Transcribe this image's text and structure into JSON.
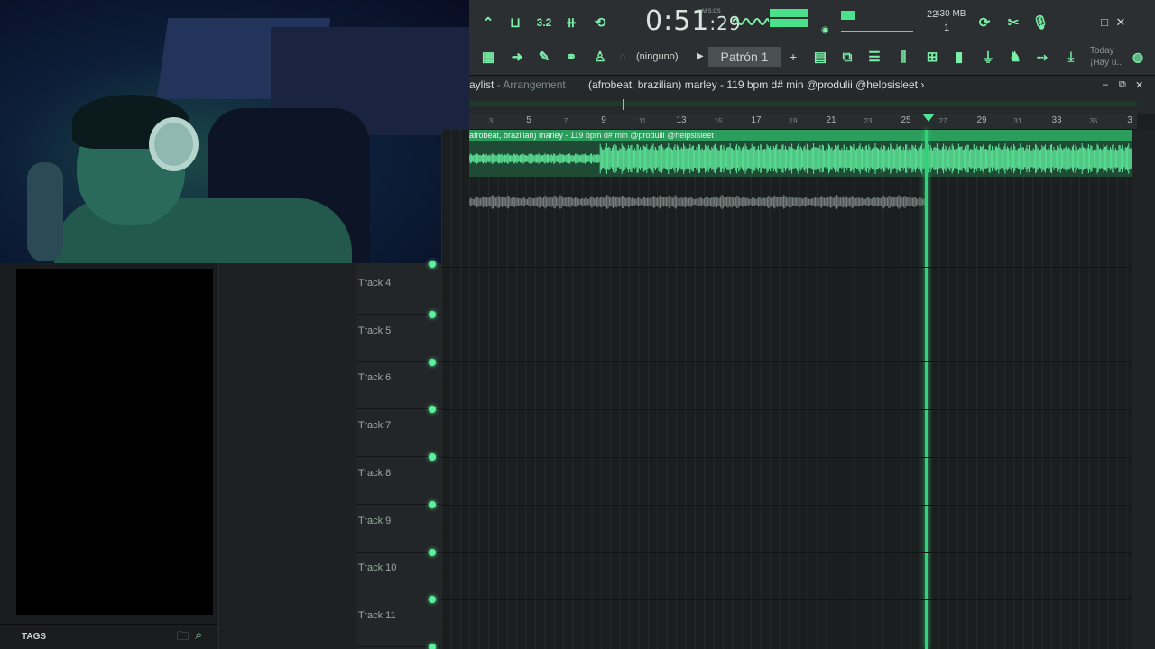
{
  "toolbar": {
    "time_main": "0:51",
    "time_sub": "29",
    "time_format_label": "M:S:CS",
    "cpu_value": "22",
    "memory": "430 MB",
    "voices": "1",
    "snap_label": "(ninguno)",
    "pattern_label": "Patrón 1",
    "pattern_add": "+",
    "today_line1": "Today",
    "today_line2": "¡Hay u..",
    "accent_color": "#4be08a"
  },
  "playlist": {
    "title_prefix": "aylist",
    "title_separator": " - ",
    "title_mode": "Arrangement",
    "pattern_name": "(afrobeat, brazilian) marley - 119 bpm d# min @produlii @helpsisleet",
    "pattern_arrow": "›",
    "clip_label": "afrobeat, brazilian) marley - 119 bpm d# min @produlii @helpsisleet",
    "ruler": [
      "3",
      "5",
      "7",
      "9",
      "11",
      "13",
      "15",
      "17",
      "19",
      "21",
      "23",
      "25",
      "27",
      "29",
      "31",
      "33",
      "35",
      "3"
    ],
    "tracks": [
      "Track 4",
      "Track 5",
      "Track 6",
      "Track 7",
      "Track 8",
      "Track 9",
      "Track 10",
      "Track 11"
    ]
  },
  "browser": {
    "tags_label": "TAGS"
  }
}
